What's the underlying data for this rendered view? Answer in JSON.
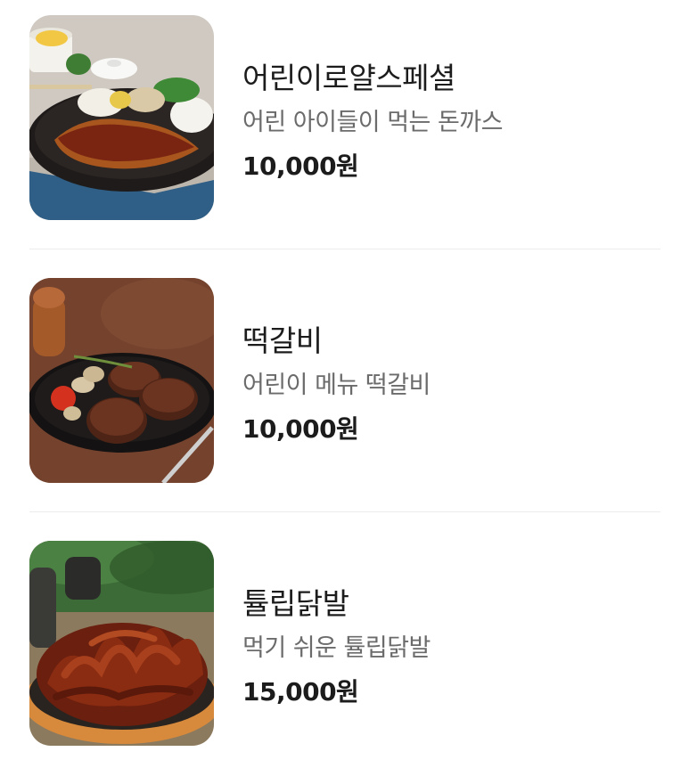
{
  "menu": {
    "items": [
      {
        "name": "어린이로얄스페셜",
        "description": "어린 아이들이 먹는 돈까스",
        "price": "10,000원",
        "image_icon": "tonkatsu-plate-photo"
      },
      {
        "name": "떡갈비",
        "description": "어린이 메뉴 떡갈비",
        "price": "10,000원",
        "image_icon": "tteokgalbi-plate-photo"
      },
      {
        "name": "튤립닭발",
        "description": "먹기 쉬운 튤립닭발",
        "price": "15,000원",
        "image_icon": "chicken-feet-platter-photo"
      }
    ]
  }
}
